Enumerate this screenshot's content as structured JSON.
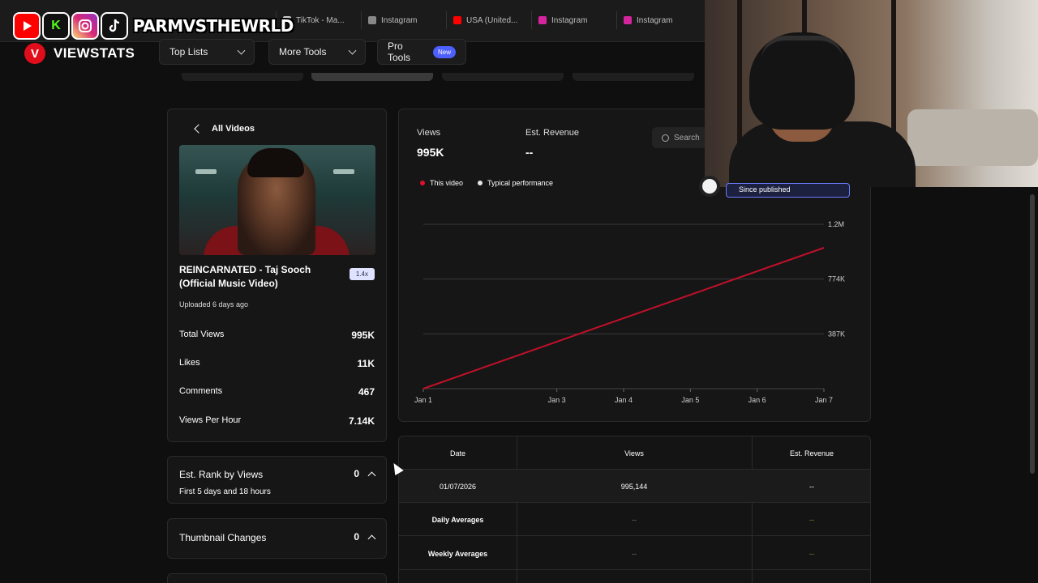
{
  "browser_tabs": [
    {
      "label": "TikTok - Ma...",
      "color": "#cccccc"
    },
    {
      "label": "Instagram",
      "color": "#888888"
    },
    {
      "label": "USA (United...",
      "color": "#ff0000"
    },
    {
      "label": "Instagram",
      "color": "#d6249f"
    },
    {
      "label": "Instagram",
      "color": "#d6249f"
    }
  ],
  "overlay": {
    "icons": [
      "youtube-icon",
      "kick-icon",
      "instagram-icon",
      "tiktok-icon"
    ],
    "handle": "PARMVSTHEWRLD"
  },
  "brand": {
    "logo_letter": "V",
    "name": "VIEWSTATS"
  },
  "nav": {
    "top_lists": "Top Lists",
    "more_tools": "More Tools",
    "pro_tools": "Pro Tools",
    "pro_badge": "New"
  },
  "video": {
    "back_label": "All Videos",
    "title": "REINCARNATED - Taj Sooch (Official Music Video)",
    "multiplier": "1.4x",
    "uploaded": "Uploaded 6 days ago",
    "stats": [
      {
        "label": "Total Views",
        "value": "995K"
      },
      {
        "label": "Likes",
        "value": "11K"
      },
      {
        "label": "Comments",
        "value": "467"
      },
      {
        "label": "Views Per Hour",
        "value": "7.14K"
      }
    ]
  },
  "accordions": {
    "rank_title": "Est. Rank by Views",
    "rank_value": "0",
    "rank_sub": "First 5 days and 18 hours",
    "thumb_title": "Thumbnail Changes",
    "thumb_value": "0"
  },
  "chart_panel": {
    "views_label": "Views",
    "views_value": "995K",
    "revenue_label": "Est. Revenue",
    "revenue_value": "--",
    "search_placeholder": "Search",
    "range_label": "Since published",
    "legend": [
      {
        "name": "This video",
        "color": "#e0102a"
      },
      {
        "name": "Typical performance",
        "color": "#e6e6e6"
      }
    ]
  },
  "chart_data": {
    "type": "line",
    "x": [
      "Jan 1",
      "Jan 3",
      "Jan 4",
      "Jan 5",
      "Jan 6",
      "Jan 7"
    ],
    "x_days": [
      1,
      3,
      4,
      5,
      6,
      7
    ],
    "y_ticks": [
      "387K",
      "774K",
      "1.2M"
    ],
    "y_tick_values": [
      387000,
      774000,
      1161000
    ],
    "ylim": [
      0,
      1161000
    ],
    "series": [
      {
        "name": "This video",
        "color": "#c0102a",
        "points": [
          [
            1,
            0
          ],
          [
            7,
            995144
          ]
        ]
      }
    ],
    "grid": true,
    "legend": "top-left"
  },
  "table": {
    "headers": [
      "Date",
      "Views",
      "Est. Revenue"
    ],
    "rows": [
      [
        "01/07/2026",
        "995,144",
        "--"
      ],
      [
        "Daily Averages",
        "--",
        "--"
      ],
      [
        "Weekly Averages",
        "--",
        "--"
      ]
    ]
  }
}
